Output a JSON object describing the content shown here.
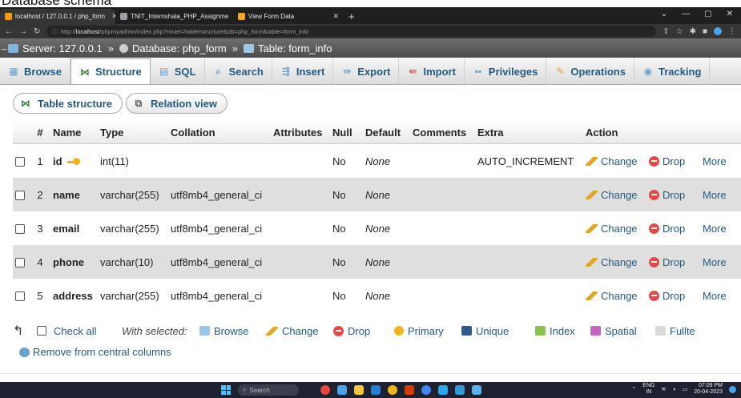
{
  "caption": "Database schema",
  "browser": {
    "tabs": [
      {
        "title": "localhost / 127.0.0.1 / php_form",
        "favicon_color": "#f39c12",
        "active": true
      },
      {
        "title": "TNIT_Internshala_PHP_Assignme",
        "favicon_color": "#9aa0a6",
        "active": false
      },
      {
        "title": "View Form Data",
        "favicon_color": "#f5a623",
        "active": false
      }
    ],
    "url_prefix": "http://",
    "url_host": "localhost",
    "url_path": "/phpmyadmin/index.php?route=/table/structure&db=php_form&table=form_info"
  },
  "breadcrumb": {
    "server_label": "Server: 127.0.0.1",
    "database_label": "Database: php_form",
    "table_label": "Table: form_info"
  },
  "top_tabs": [
    {
      "label": "Browse",
      "icon": "browse-icon",
      "active": false
    },
    {
      "label": "Structure",
      "icon": "structure-icon",
      "active": true
    },
    {
      "label": "SQL",
      "icon": "sql-icon",
      "active": false
    },
    {
      "label": "Search",
      "icon": "search-icon",
      "active": false
    },
    {
      "label": "Insert",
      "icon": "insert-icon",
      "active": false
    },
    {
      "label": "Export",
      "icon": "export-icon",
      "active": false
    },
    {
      "label": "Import",
      "icon": "import-icon",
      "active": false
    },
    {
      "label": "Privileges",
      "icon": "privileges-icon",
      "active": false
    },
    {
      "label": "Operations",
      "icon": "operations-icon",
      "active": false
    },
    {
      "label": "Tracking",
      "icon": "tracking-icon",
      "active": false
    }
  ],
  "sub_tabs": [
    {
      "label": "Table structure",
      "active": true
    },
    {
      "label": "Relation view",
      "active": false
    }
  ],
  "table": {
    "headers": {
      "num": "#",
      "name": "Name",
      "type": "Type",
      "collation": "Collation",
      "attributes": "Attributes",
      "null": "Null",
      "default": "Default",
      "comments": "Comments",
      "extra": "Extra",
      "action": "Action"
    },
    "rows": [
      {
        "num": "1",
        "name": "id",
        "primary_key": true,
        "type": "int(11)",
        "collation": "",
        "attributes": "",
        "null": "No",
        "default": "None",
        "comments": "",
        "extra": "AUTO_INCREMENT"
      },
      {
        "num": "2",
        "name": "name",
        "primary_key": false,
        "type": "varchar(255)",
        "collation": "utf8mb4_general_ci",
        "attributes": "",
        "null": "No",
        "default": "None",
        "comments": "",
        "extra": ""
      },
      {
        "num": "3",
        "name": "email",
        "primary_key": false,
        "type": "varchar(255)",
        "collation": "utf8mb4_general_ci",
        "attributes": "",
        "null": "No",
        "default": "None",
        "comments": "",
        "extra": ""
      },
      {
        "num": "4",
        "name": "phone",
        "primary_key": false,
        "type": "varchar(10)",
        "collation": "utf8mb4_general_ci",
        "attributes": "",
        "null": "No",
        "default": "None",
        "comments": "",
        "extra": ""
      },
      {
        "num": "5",
        "name": "address",
        "primary_key": false,
        "type": "varchar(255)",
        "collation": "utf8mb4_general_ci",
        "attributes": "",
        "null": "No",
        "default": "None",
        "comments": "",
        "extra": ""
      }
    ],
    "row_actions": {
      "change": "Change",
      "drop": "Drop",
      "more": "More"
    }
  },
  "bulk": {
    "check_all": "Check all",
    "with_selected": "With selected:",
    "browse": "Browse",
    "change": "Change",
    "drop": "Drop",
    "primary": "Primary",
    "unique": "Unique",
    "index": "Index",
    "spatial": "Spatial",
    "fulltext": "Fullte"
  },
  "remove_central": "Remove from central columns",
  "taskbar": {
    "search": "Search",
    "lang_top": "ENG",
    "lang_bottom": "IN",
    "time": "07:09 PM",
    "date": "20-04-2023"
  },
  "colors": {
    "link": "#235a81",
    "row_even": "#dfdfdf",
    "drop": "#e14a4a",
    "pencil": "#e1a72a",
    "key": "#f0b51a"
  }
}
